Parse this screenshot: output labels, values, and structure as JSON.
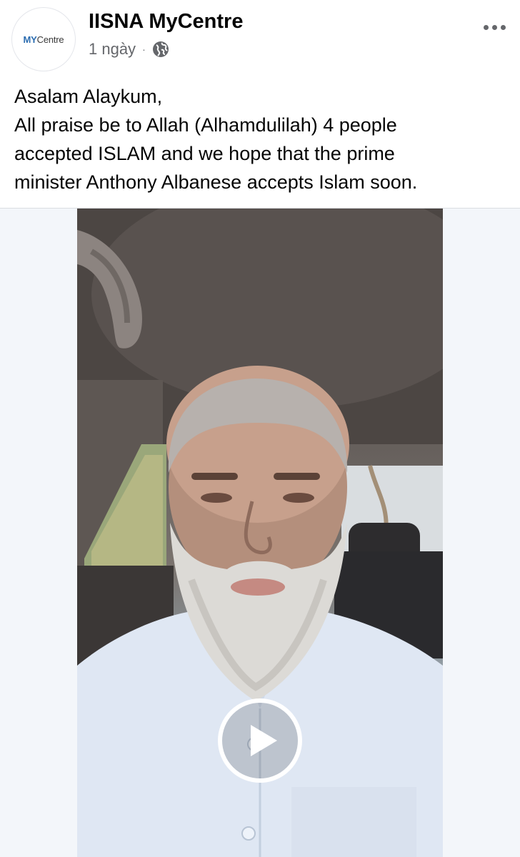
{
  "post": {
    "page_name": "IISNA MyCentre",
    "timestamp": "1 ngày",
    "separator": "·",
    "audience_icon": "globe-icon",
    "more_icon": "more-horizontal-icon",
    "avatar": {
      "logo_my": "MY",
      "logo_centre": "Centre"
    },
    "caption_lines": [
      "Asalam Alaykum,",
      "All praise be to Allah (Alhamdulilah) 4 people",
      "accepted ISLAM and we hope that the prime",
      "minister Anthony Albanese accepts Islam soon."
    ],
    "video": {
      "play_icon": "play-icon"
    }
  },
  "colors": {
    "text_primary": "#050505",
    "text_secondary": "#65676b",
    "media_background": "#f3f6fa",
    "logo_blue": "#2b6cb0"
  }
}
